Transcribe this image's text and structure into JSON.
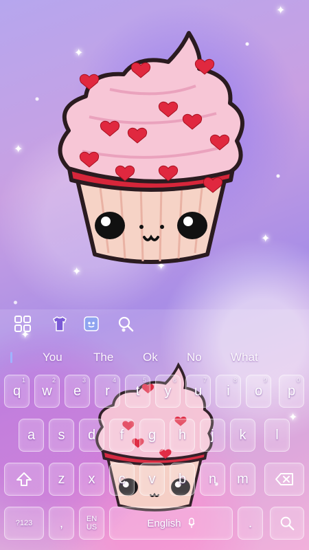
{
  "colors": {
    "accent": "#d6263a",
    "frosting": "#f7c6d6",
    "wrapper": "#f6d3c6",
    "key_border": "#ffffff"
  },
  "toolbar": {
    "items": [
      {
        "icon": "grid-menu-icon"
      },
      {
        "icon": "theme-shirt-icon"
      },
      {
        "icon": "sticker-icon"
      },
      {
        "icon": "search-icon"
      }
    ]
  },
  "suggestions": [
    "You",
    "The",
    "Ok",
    "No",
    "What"
  ],
  "keyboard": {
    "row1": [
      {
        "label": "q",
        "hint": "1"
      },
      {
        "label": "w",
        "hint": "2"
      },
      {
        "label": "e",
        "hint": "3"
      },
      {
        "label": "r",
        "hint": "4"
      },
      {
        "label": "t",
        "hint": "5"
      },
      {
        "label": "y",
        "hint": "6"
      },
      {
        "label": "u",
        "hint": "7"
      },
      {
        "label": "i",
        "hint": "8"
      },
      {
        "label": "o",
        "hint": "9"
      },
      {
        "label": "p",
        "hint": "0"
      }
    ],
    "row2": [
      "a",
      "s",
      "d",
      "f",
      "g",
      "h",
      "j",
      "k",
      "l"
    ],
    "row3": [
      "z",
      "x",
      "c",
      "v",
      "b",
      "n",
      "m"
    ],
    "symbols_label": "?123",
    "comma_label": ",",
    "lang_label": "EN\nUS",
    "space_label": "English",
    "period_label": "."
  }
}
